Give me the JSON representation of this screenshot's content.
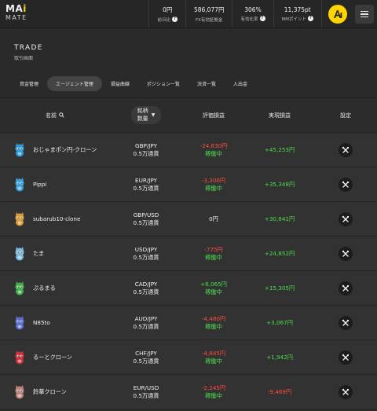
{
  "header": {
    "logo_top_prefix": "MA",
    "logo_top_accent": "i",
    "logo_bottom": "MATE",
    "stats": [
      {
        "value": "0円",
        "label": "前日比",
        "help": "?"
      },
      {
        "value": "586,077円",
        "label": "FX有効証拠金",
        "help": ""
      },
      {
        "value": "306%",
        "label": "有効比率",
        "help": "?"
      },
      {
        "value": "11,375pt",
        "label": "MMポイント",
        "help": "?"
      }
    ]
  },
  "page": {
    "title": "TRADE",
    "subtitle": "取引画面"
  },
  "tabs": [
    {
      "label": "資金管理",
      "active": false
    },
    {
      "label": "エージェント管理",
      "active": true
    },
    {
      "label": "損益曲線",
      "active": false
    },
    {
      "label": "ポジション一覧",
      "active": false
    },
    {
      "label": "決済一覧",
      "active": false
    },
    {
      "label": "入出金",
      "active": false
    }
  ],
  "table": {
    "headers": {
      "name": "名前",
      "symbol_line1": "銘柄",
      "symbol_line2": "数量",
      "eval": "評価損益",
      "realized": "実現損益",
      "settings": "設定"
    },
    "rows": [
      {
        "name": "おじゃまポン円-クローン",
        "pair": "GBP/JPY",
        "qty": "0.5万通貨",
        "eval": "-24,630円",
        "eval_sign": "neg",
        "status": "稼働中",
        "realized": "+45,253円",
        "realized_sign": "pos",
        "pet_color": "#2e9bd6"
      },
      {
        "name": "Pippi",
        "pair": "EUR/JPY",
        "qty": "0.5万通貨",
        "eval": "-3,300円",
        "eval_sign": "neg",
        "status": "稼働中",
        "realized": "+35,348円",
        "realized_sign": "pos",
        "pet_color": "#3aa0d8"
      },
      {
        "name": "subarub10-clone",
        "pair": "GBP/USD",
        "qty": "0.5万通貨",
        "eval": "0円",
        "eval_sign": "zero",
        "status": "",
        "realized": "+30,841円",
        "realized_sign": "pos",
        "pet_color": "#d99a3a"
      },
      {
        "name": "たま",
        "pair": "USD/JPY",
        "qty": "0.5万通貨",
        "eval": "-775円",
        "eval_sign": "neg",
        "status": "稼働中",
        "realized": "+24,852円",
        "realized_sign": "pos",
        "pet_color": "#7ab8d8"
      },
      {
        "name": "ぷるまる",
        "pair": "CAD/JPY",
        "qty": "0.5万通貨",
        "eval": "+6,065円",
        "eval_sign": "pos",
        "status": "稼働中",
        "realized": "+15,305円",
        "realized_sign": "pos",
        "pet_color": "#3fae4a"
      },
      {
        "name": "N85to",
        "pair": "AUD/JPY",
        "qty": "0.5万通貨",
        "eval": "-4,480円",
        "eval_sign": "neg",
        "status": "稼働中",
        "realized": "+3,067円",
        "realized_sign": "pos",
        "pet_color": "#5a6fd0"
      },
      {
        "name": "るーとクローン",
        "pair": "CHF/JPY",
        "qty": "0.5万通貨",
        "eval": "-4,845円",
        "eval_sign": "neg",
        "status": "稼働中",
        "realized": "+1,942円",
        "realized_sign": "pos",
        "pet_color": "#c8323a"
      },
      {
        "name": "鈴華クローン",
        "pair": "EUR/USD",
        "qty": "0.5万通貨",
        "eval": "-2,245円",
        "eval_sign": "neg",
        "status": "稼働中",
        "realized": "-9,469円",
        "realized_sign": "neg",
        "pet_color": "#b8837a"
      }
    ]
  }
}
